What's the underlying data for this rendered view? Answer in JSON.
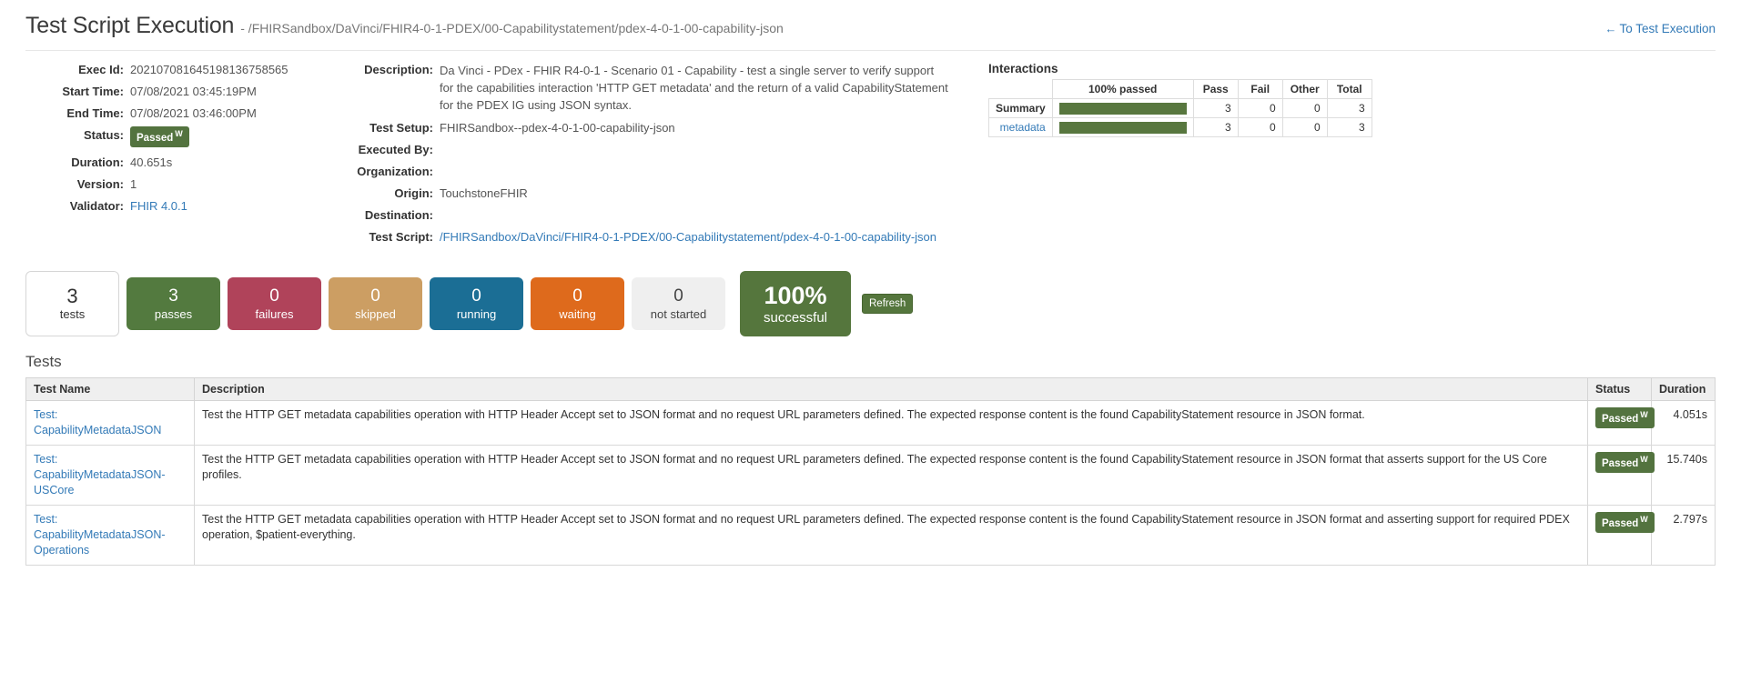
{
  "header": {
    "title": "Test Script Execution",
    "subtitle": "- /FHIRSandbox/DaVinci/FHIR4-0-1-PDEX/00-Capabilitystatement/pdex-4-0-1-00-capability-json",
    "back_link": "To Test Execution",
    "back_arrow": "←"
  },
  "execution": {
    "exec_id_label": "Exec Id:",
    "exec_id": "20210708164519813675 8565",
    "exec_id_value": "202107081645198136758565",
    "start_time_label": "Start Time:",
    "start_time": "07/08/2021 03:45:19PM",
    "end_time_label": "End Time:",
    "end_time": "07/08/2021 03:46:00PM",
    "status_label": "Status:",
    "status": "Passed",
    "status_sup": "W",
    "duration_label": "Duration:",
    "duration": "40.651s",
    "version_label": "Version:",
    "version": "1",
    "validator_label": "Validator:",
    "validator": "FHIR 4.0.1"
  },
  "details": {
    "description_label": "Description:",
    "description": "Da Vinci - PDex - FHIR R4-0-1 - Scenario 01 - Capability - test a single server to verify support for the capabilities interaction 'HTTP GET metadata' and the return of a valid CapabilityStatement for the PDEX IG using JSON syntax.",
    "test_setup_label": "Test Setup:",
    "test_setup": "FHIRSandbox--pdex-4-0-1-00-capability-json",
    "executed_by_label": "Executed By:",
    "executed_by": "",
    "organization_label": "Organization:",
    "organization": "",
    "origin_label": "Origin:",
    "origin": "TouchstoneFHIR",
    "destination_label": "Destination:",
    "destination": "",
    "test_script_label": "Test Script:",
    "test_script": "/FHIRSandbox/DaVinci/FHIR4-0-1-PDEX/00-Capabilitystatement/pdex-4-0-1-00-capability-json"
  },
  "interactions": {
    "title": "Interactions",
    "columns": [
      "",
      "100% passed",
      "Pass",
      "Fail",
      "Other",
      "Total"
    ],
    "rows": [
      {
        "name": "Summary",
        "is_link": false,
        "percent": 100,
        "pass": "3",
        "fail": "0",
        "other": "0",
        "total": "3"
      },
      {
        "name": "metadata",
        "is_link": true,
        "percent": 100,
        "pass": "3",
        "fail": "0",
        "other": "0",
        "total": "3"
      }
    ]
  },
  "tiles": [
    {
      "key": "tests",
      "num": "3",
      "label": "tests",
      "color": "#ffffff"
    },
    {
      "key": "passes",
      "num": "3",
      "label": "passes",
      "color": "#537a3f"
    },
    {
      "key": "failures",
      "num": "0",
      "label": "failures",
      "color": "#b0435a"
    },
    {
      "key": "skipped",
      "num": "0",
      "label": "skipped",
      "color": "#cc9e63"
    },
    {
      "key": "running",
      "num": "0",
      "label": "running",
      "color": "#1b6e95"
    },
    {
      "key": "waiting",
      "num": "0",
      "label": "waiting",
      "color": "#de6a1c"
    },
    {
      "key": "notstarted",
      "num": "0",
      "label": "not started",
      "color": "#efefef"
    }
  ],
  "success": {
    "percent": "100%",
    "label": "successful",
    "refresh_label": "Refresh"
  },
  "tests_section": {
    "heading": "Tests",
    "columns": {
      "name": "Test Name",
      "description": "Description",
      "status": "Status",
      "duration": "Duration"
    },
    "rows": [
      {
        "name_prefix": "Test:",
        "name": "CapabilityMetadataJSON",
        "description": "Test the HTTP GET metadata capabilities operation with HTTP Header Accept set to JSON format and no request URL parameters defined. The expected response content is the found CapabilityStatement resource in JSON format.",
        "status": "Passed",
        "status_sup": "W",
        "duration": "4.051s"
      },
      {
        "name_prefix": "Test:",
        "name": "CapabilityMetadataJSON-USCore",
        "description": "Test the HTTP GET metadata capabilities operation with HTTP Header Accept set to JSON format and no request URL parameters defined. The expected response content is the found CapabilityStatement resource in JSON format that asserts support for the US Core profiles.",
        "status": "Passed",
        "status_sup": "W",
        "duration": "15.740s"
      },
      {
        "name_prefix": "Test:",
        "name": "CapabilityMetadataJSON-Operations",
        "description": "Test the HTTP GET metadata capabilities operation with HTTP Header Accept set to JSON format and no request URL parameters defined. The expected response content is the found CapabilityStatement resource in JSON format and asserting support for required PDEX operation, $patient-everything.",
        "status": "Passed",
        "status_sup": "W",
        "duration": "2.797s"
      }
    ]
  }
}
